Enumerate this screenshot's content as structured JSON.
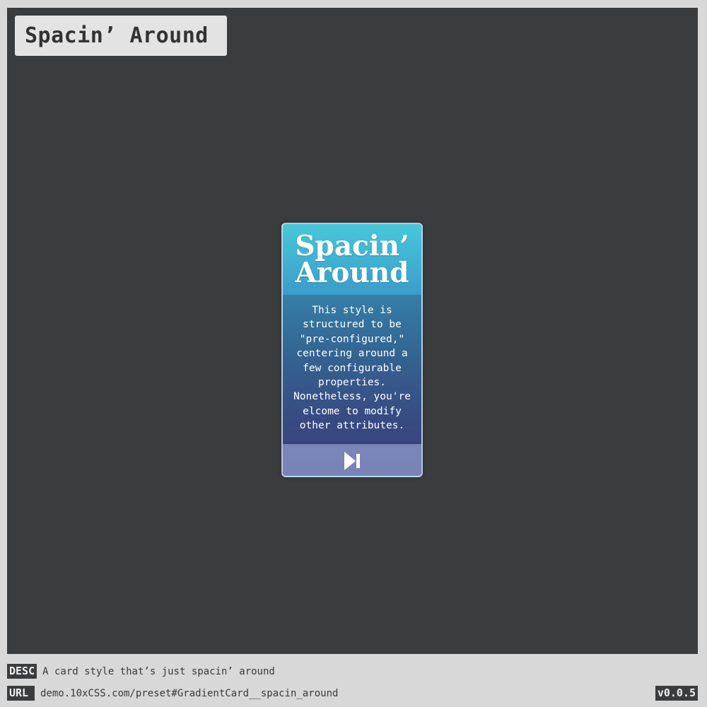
{
  "page": {
    "title": "Spacin’ Around"
  },
  "card": {
    "title_line1": "Spacin’",
    "title_line2": "Around",
    "body": "This style is\nstructured to be\n\"pre-configured,\"\ncentering around a\nfew configurable\nproperties.\nNonetheless, you're\nelcome to modify\nother attributes.",
    "next_icon": "skip-forward-icon"
  },
  "footer": {
    "desc_tag": "DESC",
    "desc_text": "A card style that’s just spacin’ around",
    "url_tag": "URL",
    "url_text": "demo.10xCSS.com/preset#GradientCard__spacin_around",
    "version": "v0.0.5"
  },
  "colors": {
    "background": "#d8d8d8",
    "stage": "#3a3c3e",
    "card_top": "#48c7da",
    "card_bottom": "#444a8e"
  }
}
